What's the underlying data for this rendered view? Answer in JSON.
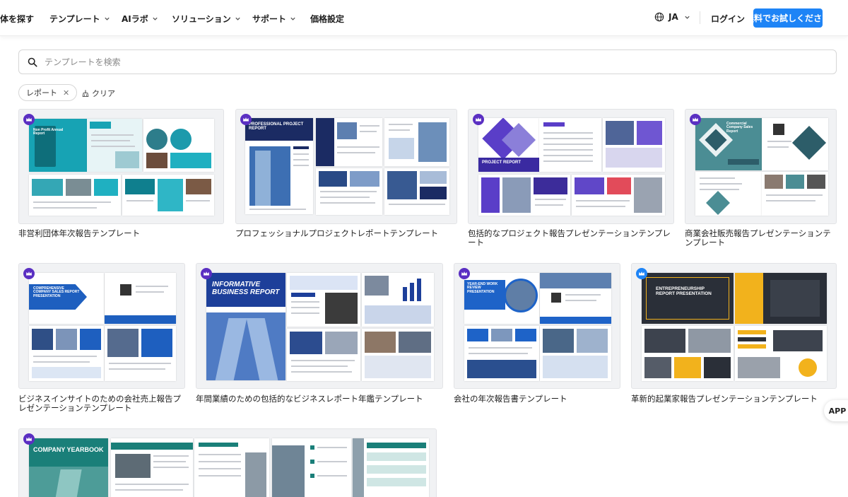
{
  "header": {
    "nav": [
      {
        "label": "体を探す",
        "dropdown": false
      },
      {
        "label": "テンプレート",
        "dropdown": true
      },
      {
        "label": "AIラボ",
        "dropdown": true
      },
      {
        "label": "ソリューション",
        "dropdown": true
      },
      {
        "label": "サポート",
        "dropdown": true
      },
      {
        "label": "価格設定",
        "dropdown": false
      }
    ],
    "language": "JA",
    "login_label": "ログイン",
    "trial_label": "無料でお試しください"
  },
  "search": {
    "placeholder": "テンプレートを検索"
  },
  "filters": {
    "chip_label": "レポート",
    "clear_label": "クリア"
  },
  "colors": {
    "accent": "#1e84f6",
    "premium_badge": "#5a2fc2",
    "badge_alt": "#1e84f6"
  },
  "templates": [
    {
      "title": "非営利団体年次報告テンプレート",
      "cover_text": "Non Profit Annual Report",
      "badge": "crown-icon"
    },
    {
      "title": "プロフェッショナルプロジェクトレポートテンプレート",
      "cover_text": "PROFESSIONAL PROJECT REPORT",
      "badge": "crown-icon"
    },
    {
      "title": "包括的なプロジェクト報告プレゼンテーションテンプレート",
      "cover_text": "PROJECT REPORT",
      "badge": "crown-icon"
    },
    {
      "title": "商業会社販売報告プレゼンテーションテンプレート",
      "cover_text": "Commercial Company Sales Report",
      "badge": "crown-icon"
    },
    {
      "title": "ビジネスインサイトのための会社売上報告プレゼンテーションテンプレート",
      "cover_text": "COMPREHENSIVE COMPANY SALES REPORT PRESENTATION",
      "badge": "crown-icon"
    },
    {
      "title": "年間業績のための包括的なビジネスレポート年鑑テンプレート",
      "cover_text": "INFORMATIVE BUSINESS REPORT",
      "badge": "crown-icon"
    },
    {
      "title": "会社の年次報告書テンプレート",
      "cover_text": "YEAR-END WORK REVIEW PRESENTATION",
      "badge": "crown-icon"
    },
    {
      "title": "革新的起業家報告プレゼンテーションテンプレート",
      "cover_text": "ENTREPRENEURSHIP REPORT PRESENTATION",
      "badge": "crown-icon"
    },
    {
      "title": "",
      "cover_text": "COMPANY YEARBOOK",
      "badge": "crown-icon"
    }
  ],
  "app_button": "APP"
}
